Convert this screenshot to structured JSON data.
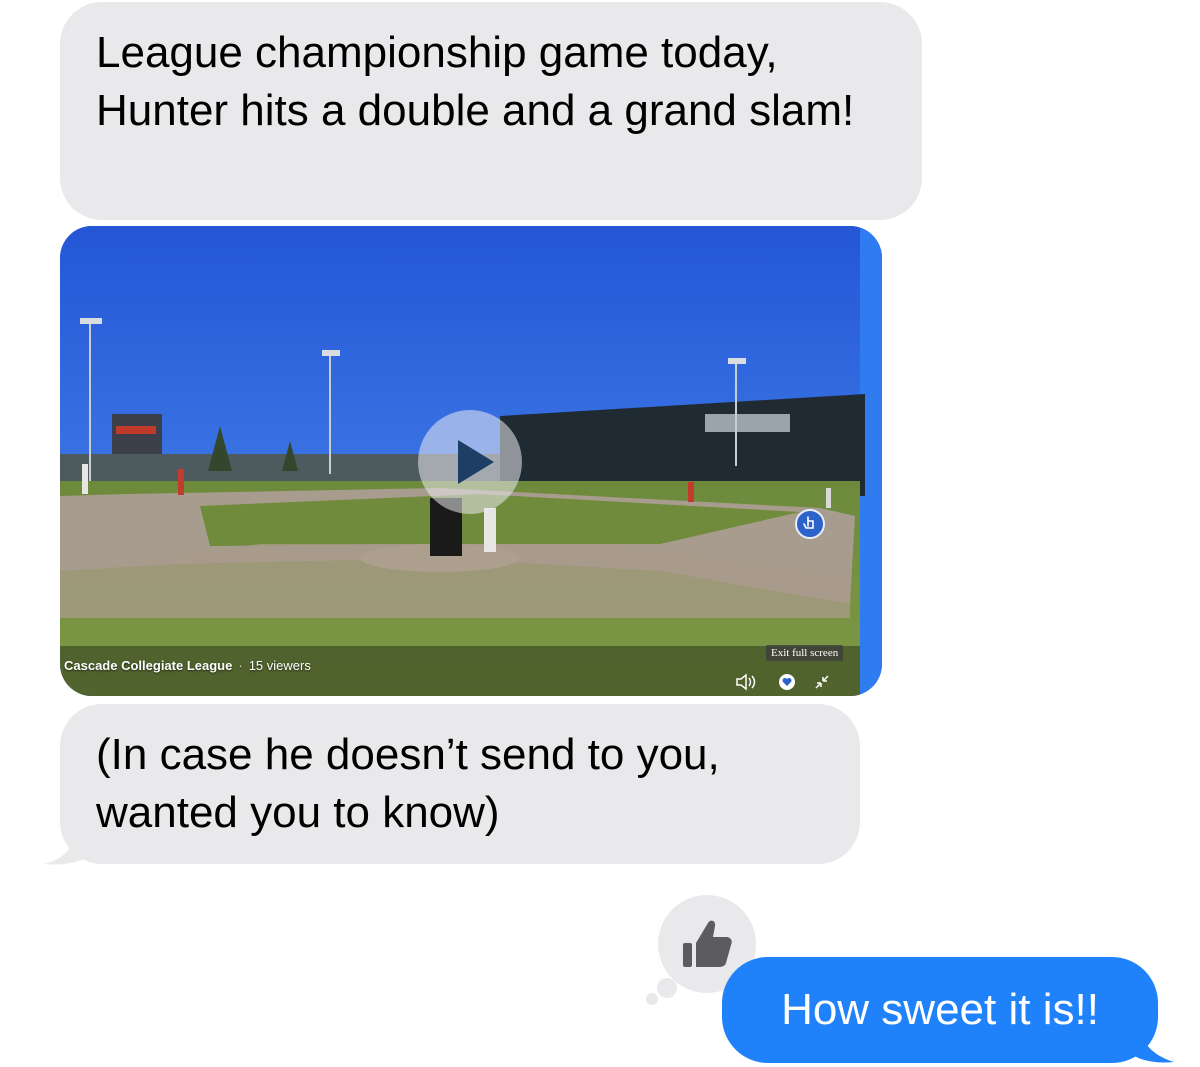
{
  "messages": {
    "incoming_1": "League championship game today, Hunter hits a double and a grand slam!",
    "incoming_2": "(In case he doesn’t send to you, wanted you to know)",
    "outgoing_1": "How sweet it is!!"
  },
  "video": {
    "channel": "Cascade Collegiate League",
    "separator": "·",
    "viewers": "15 viewers",
    "exit_label": "Exit full screen",
    "icons": [
      "play-icon",
      "volume-icon",
      "heart-icon",
      "exit-fullscreen-icon",
      "hand-pointer-icon"
    ]
  },
  "reaction": {
    "icon": "thumbs-up-icon"
  },
  "colors": {
    "incoming_bubble": "#e9e9eb",
    "outgoing_bubble": "#1f82fb",
    "reaction_icon": "#5b5b60"
  }
}
